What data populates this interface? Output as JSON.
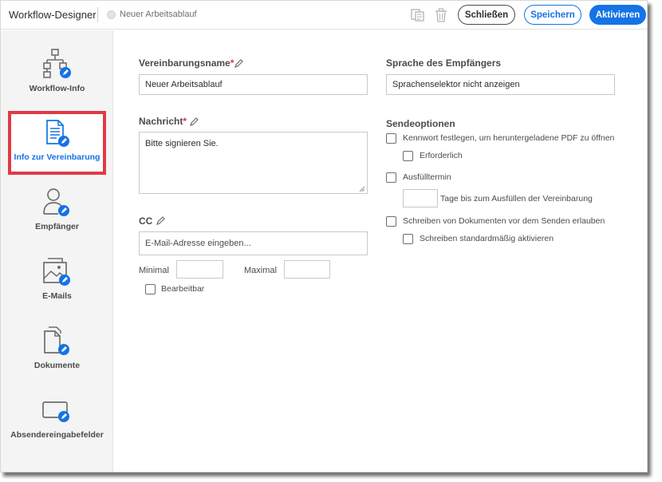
{
  "header": {
    "app_title": "Workflow-Designer",
    "workflow_name": "Neuer Arbeitsablauf",
    "close_label": "Schließen",
    "save_label": "Speichern",
    "activate_label": "Aktivieren"
  },
  "sidebar": {
    "items": [
      {
        "label": "Workflow-Info",
        "icon": "workflow-hierarchy-icon"
      },
      {
        "label": "Info zur Vereinbarung",
        "icon": "agreement-document-icon",
        "active": true
      },
      {
        "label": "Empfänger",
        "icon": "recipient-user-icon"
      },
      {
        "label": "E-Mails",
        "icon": "email-image-icon"
      },
      {
        "label": "Dokumente",
        "icon": "documents-icon"
      },
      {
        "label": "Absendereingabefelder",
        "icon": "sender-input-field-icon"
      }
    ]
  },
  "form": {
    "agreement_name": {
      "label": "Vereinbarungsname",
      "required_mark": "*",
      "value": "Neuer Arbeitsablauf"
    },
    "message": {
      "label": "Nachricht",
      "required_mark": "*",
      "value": "Bitte signieren Sie."
    },
    "cc": {
      "label": "CC",
      "placeholder": "E-Mail-Adresse eingeben...",
      "min_label": "Minimal",
      "max_label": "Maximal",
      "editable_label": "Bearbeitbar",
      "editable_checked": false
    },
    "recipient_language": {
      "label": "Sprache des Empfängers",
      "value": "Sprachenselektor nicht anzeigen"
    },
    "send_options": {
      "label": "Sendeoptionen",
      "password_label": "Kennwort festlegen, um heruntergeladene PDF zu öffnen",
      "password_checked": false,
      "required_label": "Erforderlich",
      "required_checked": false,
      "deadline_label": "Ausfülltermin",
      "deadline_checked": false,
      "days_label": "Tage bis zum Ausfüllen der Vereinbarung",
      "write_docs_label": "Schreiben von Dokumenten vor dem Senden erlauben",
      "write_docs_checked": false,
      "write_default_label": "Schreiben standardmäßig aktivieren",
      "write_default_checked": false
    }
  },
  "colors": {
    "accent": "#1473e6",
    "highlight": "#e03a47",
    "required": "#d7373f"
  }
}
